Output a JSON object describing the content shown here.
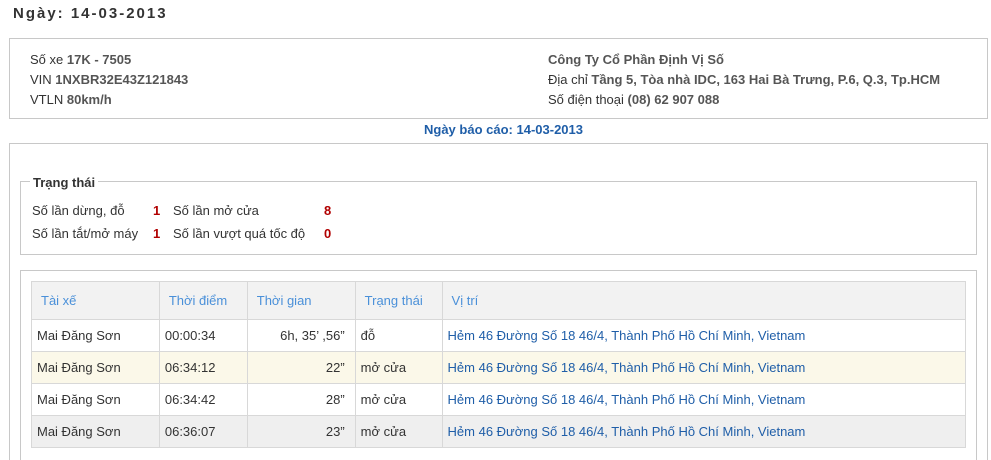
{
  "header": {
    "title": "Ngày: 14-03-2013"
  },
  "vehicle": {
    "plate_label": "Số xe",
    "plate": "17K - 7505",
    "vin_label": "VIN",
    "vin": "1NXBR32E43Z121843",
    "speed_limit_label": "VTLN",
    "speed_limit": "80km/h"
  },
  "company": {
    "name": "Công Ty Cổ Phần Định Vị Số",
    "address_label": "Địa chỉ",
    "address": "Tầng 5, Tòa nhà IDC, 163 Hai Bà Trưng, P.6, Q.3, Tp.HCM",
    "phone_label": "Số điện thoại",
    "phone": "(08) 62 907 088"
  },
  "report": {
    "date_label": "Ngày báo cáo:",
    "date": "14-03-2013"
  },
  "status": {
    "legend": "Trạng thái",
    "stops_label": "Số lần dừng, đỗ",
    "stops": "1",
    "door_label": "Số lần mở cửa",
    "door": "8",
    "engine_label": "Số lần tắt/mở máy",
    "engine": "1",
    "overspeed_label": "Số lần vượt quá tốc độ",
    "overspeed": "0"
  },
  "table": {
    "headers": [
      "Tài xế",
      "Thời điểm",
      "Thời gian",
      "Trạng thái",
      "Vị trí"
    ],
    "rows": [
      [
        "Mai Đăng Sơn",
        "00:00:34",
        "6h, 35’ ,56”",
        "đỗ",
        "Hẻm 46 Đường Số 18 46/4, Thành Phố Hồ Chí Minh, Vietnam"
      ],
      [
        "Mai Đăng Sơn",
        "06:34:12",
        "22”",
        "mở cửa",
        "Hẻm 46 Đường Số 18 46/4, Thành Phố Hồ Chí Minh, Vietnam"
      ],
      [
        "Mai Đăng Sơn",
        "06:34:42",
        "28”",
        "mở cửa",
        "Hẻm 46 Đường Số 18 46/4, Thành Phố Hồ Chí Minh, Vietnam"
      ],
      [
        "Mai Đăng Sơn",
        "06:36:07",
        "23”",
        "mở cửa",
        "Hẻm 46 Đường Số 18 46/4, Thành Phố Hồ Chí Minh, Vietnam"
      ]
    ]
  }
}
